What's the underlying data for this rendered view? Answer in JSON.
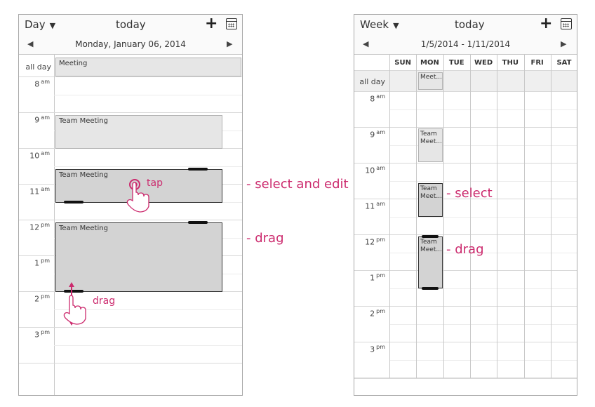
{
  "day_view": {
    "view_label": "Day",
    "today_label": "today",
    "add_label": "+",
    "date_label": "Monday, January 06, 2014",
    "allday_label": "all day",
    "allday_event": "Meeting",
    "hours": [
      {
        "h": "8",
        "ampm": "am"
      },
      {
        "h": "9",
        "ampm": "am"
      },
      {
        "h": "10",
        "ampm": "am"
      },
      {
        "h": "11",
        "ampm": "am"
      },
      {
        "h": "12",
        "ampm": "pm"
      },
      {
        "h": "1",
        "ampm": "pm"
      },
      {
        "h": "2",
        "ampm": "pm"
      },
      {
        "h": "3",
        "ampm": "pm"
      }
    ],
    "events": {
      "e1": "Team Meeting",
      "e2": "Team Meeting",
      "e3": "Team Meeting"
    },
    "tap_label": "tap",
    "drag_label": "drag"
  },
  "week_view": {
    "view_label": "Week",
    "today_label": "today",
    "add_label": "+",
    "date_label": "1/5/2014 - 1/11/2014",
    "allday_label": "all day",
    "days": [
      "SUN",
      "MON",
      "TUE",
      "WED",
      "THU",
      "FRI",
      "SAT"
    ],
    "hours": [
      {
        "h": "8",
        "ampm": "am"
      },
      {
        "h": "9",
        "ampm": "am"
      },
      {
        "h": "10",
        "ampm": "am"
      },
      {
        "h": "11",
        "ampm": "am"
      },
      {
        "h": "12",
        "ampm": "pm"
      },
      {
        "h": "1",
        "ampm": "pm"
      },
      {
        "h": "2",
        "ampm": "pm"
      },
      {
        "h": "3",
        "ampm": "pm"
      }
    ],
    "allday_event": "Meet...",
    "events": {
      "e1": "Team\nMeet...",
      "e2": "Team\nMeet...",
      "e3": "Team\nMeet..."
    }
  },
  "annotations": {
    "select_and_edit": "- select and edit",
    "drag_day": "- drag",
    "select_week": "- select",
    "drag_week": "- drag"
  },
  "colors": {
    "accent": "#cc2b6e",
    "event_fill": "#d7d7d7",
    "grid": "#d8d8d8"
  }
}
